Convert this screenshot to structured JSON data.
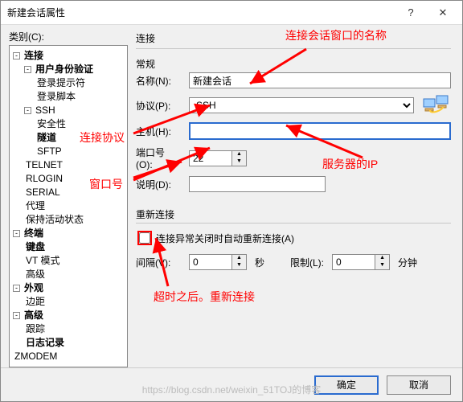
{
  "window": {
    "title": "新建会话属性",
    "help": "?",
    "close": "✕"
  },
  "left": {
    "category_label": "类别(C):",
    "tree": {
      "connection": "连接",
      "auth": "用户身份验证",
      "login_prompt": "登录提示符",
      "login_script": "登录脚本",
      "ssh": "SSH",
      "security": "安全性",
      "tunnel": "隧道",
      "sftp": "SFTP",
      "telnet": "TELNET",
      "rlogin": "RLOGIN",
      "serial": "SERIAL",
      "proxy": "代理",
      "keepalive": "保持活动状态",
      "terminal": "终端",
      "keyboard": "键盘",
      "vtmode": "VT 模式",
      "advanced_term": "高级",
      "appearance": "外观",
      "margin": "边距",
      "advanced": "高级",
      "trace": "跟踪",
      "logging": "日志记录",
      "zmodem": "ZMODEM"
    }
  },
  "right": {
    "section_connect": "连接",
    "general": "常规",
    "name_label": "名称(N):",
    "name_value": "新建会话",
    "proto_label": "协议(P):",
    "proto_value": "SSH",
    "host_label": "主机(H):",
    "host_value": "",
    "port_label": "端口号(O):",
    "port_value": "22",
    "desc_label": "说明(D):",
    "desc_value": "",
    "reconnect_section": "重新连接",
    "reconnect_cb": "连接异常关闭时自动重新连接(A)",
    "interval_label": "间隔(V):",
    "interval_value": "0",
    "seconds": "秒",
    "limit_label": "限制(L):",
    "limit_value": "0",
    "minutes": "分钟"
  },
  "footer": {
    "ok": "确定",
    "cancel": "取消"
  },
  "annotations": {
    "title_name": "连接会话窗口的名称",
    "protocol": "连接协议",
    "port": "窗口号",
    "server_ip": "服务器的IP",
    "reconnect": "超时之后。重新连接"
  },
  "watermark": "https://blog.csdn.net/weixin_51TOJ的博客"
}
